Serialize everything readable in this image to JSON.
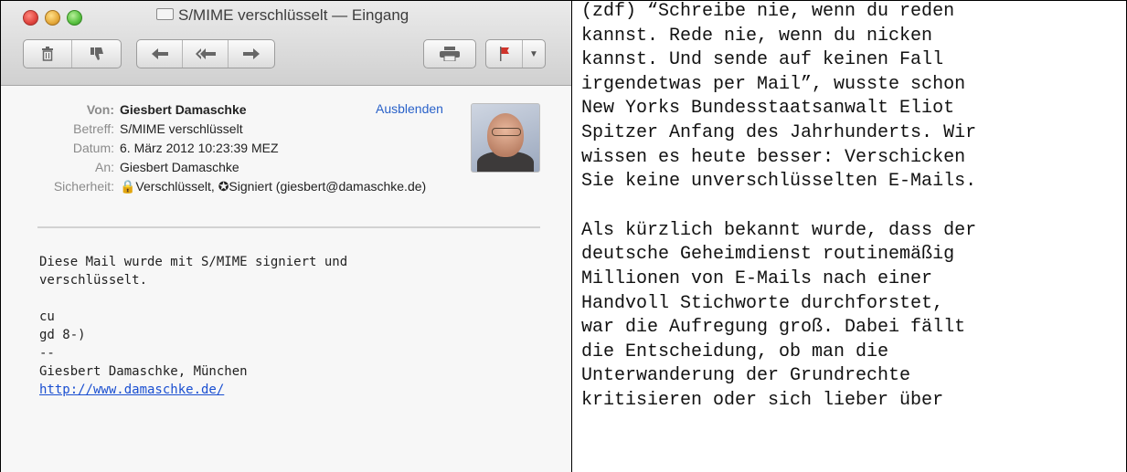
{
  "window": {
    "title": "S/MIME verschlüsselt — Eingang"
  },
  "toolbar": {
    "delete_icon": "trash-icon",
    "junk_icon": "thumbs-down-icon",
    "reply_icon": "reply-arrow-icon",
    "reply_all_icon": "reply-all-icon",
    "forward_icon": "forward-arrow-icon",
    "print_icon": "printer-icon",
    "flag_icon": "flag-icon"
  },
  "header": {
    "from_label": "Von:",
    "from_value": "Giesbert Damaschke",
    "subject_label": "Betreff:",
    "subject_value": "S/MIME verschlüsselt",
    "date_label": "Datum:",
    "date_value": "6. März 2012 10:23:39 MEZ",
    "to_label": "An:",
    "to_value": "Giesbert Damaschke",
    "security_label": "Sicherheit:",
    "security_value": "🔒Verschlüsselt, ✪Signiert (giesbert@damaschke.de)",
    "hide_link": "Ausblenden"
  },
  "body": {
    "line1": "Diese Mail wurde mit S/MIME signiert und",
    "line2": "verschlüsselt.",
    "line3": "cu",
    "line4": "gd 8-)",
    "line5": "--",
    "line6": "Giesbert Damaschke, München",
    "link": "http://www.damaschke.de/"
  },
  "article": {
    "para1": [
      "(zdf) “Schreibe nie, wenn du reden",
      "kannst. Rede nie, wenn du nicken",
      "kannst. Und sende auf keinen Fall",
      "irgendetwas per Mail”, wusste schon",
      "New Yorks Bundesstaatsanwalt Eliot",
      "Spitzer Anfang des Jahrhunderts. Wir",
      "wissen es heute besser: Verschicken",
      "Sie keine unverschlüsselten E-Mails."
    ],
    "para2": [
      "Als kürzlich bekannt wurde, dass der",
      "deutsche Geheimdienst routinemäßig",
      "Millionen von E-Mails nach einer",
      "Handvoll Stichworte durchforstet,",
      "war die Aufregung groß. Dabei fällt",
      "die Entscheidung, ob man die",
      "Unterwanderung der Grundrechte",
      "kritisieren oder sich lieber über"
    ]
  }
}
